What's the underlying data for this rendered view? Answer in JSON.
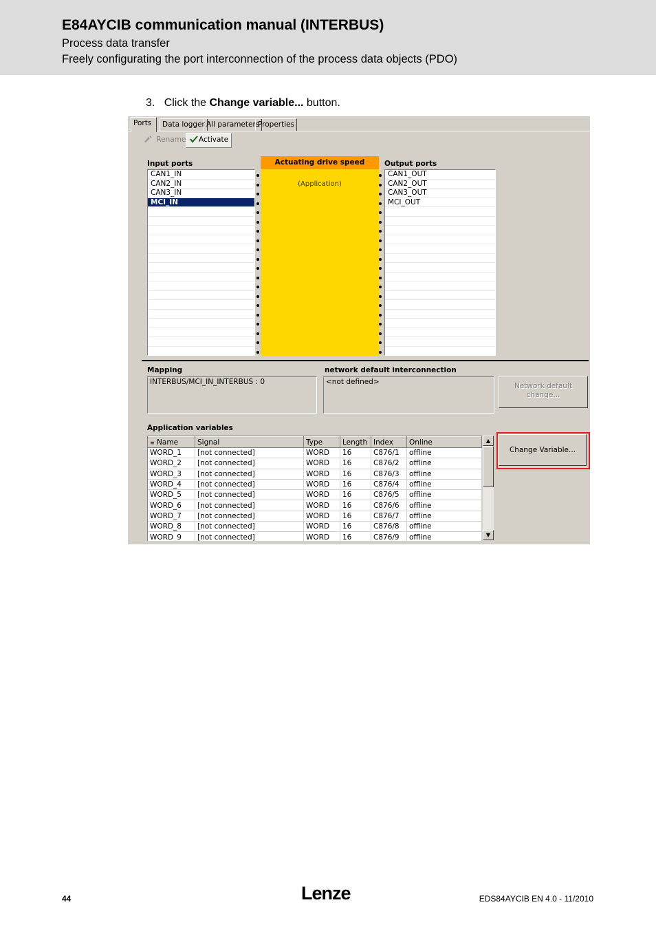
{
  "header": {
    "title": "E84AYCIB communication manual (INTERBUS)",
    "subtitle1": "Process data transfer",
    "subtitle2": "Freely configurating the port interconnection of the process data objects (PDO)"
  },
  "step": {
    "number": "3.",
    "pre": "Click the",
    "bold": "Change variable...",
    "post": "button."
  },
  "screenshot": {
    "tabs": [
      "Ports",
      "Data logger",
      "All parameters",
      "Properties"
    ],
    "toolbar": {
      "rename": "Rename",
      "activate": "Activate"
    },
    "input_ports_label": "Input ports",
    "input_ports": [
      "CAN1_IN",
      "CAN2_IN",
      "CAN3_IN",
      "MCI_IN"
    ],
    "selected_input": "MCI_IN",
    "block_title": "Actuating drive speed",
    "block_sub": "(Application)",
    "output_ports_label": "Output ports",
    "output_ports": [
      "CAN1_OUT",
      "CAN2_OUT",
      "CAN3_OUT",
      "MCI_OUT"
    ],
    "mapping_label": "Mapping",
    "mapping_value": "INTERBUS/MCI_IN_INTERBUS : 0",
    "network_label": "network default interconnection",
    "network_value": "<not defined>",
    "network_button": "Network default change...",
    "app_vars_label": "Application variables",
    "change_variable_button": "Change Variable...",
    "columns": [
      "Name",
      "Signal",
      "Type",
      "Length",
      "Index",
      "Online"
    ],
    "rows": [
      [
        "WORD_1",
        "[not connected]",
        "WORD",
        "16",
        "C876/1",
        "offline"
      ],
      [
        "WORD_2",
        "[not connected]",
        "WORD",
        "16",
        "C876/2",
        "offline"
      ],
      [
        "WORD_3",
        "[not connected]",
        "WORD",
        "16",
        "C876/3",
        "offline"
      ],
      [
        "WORD_4",
        "[not connected]",
        "WORD",
        "16",
        "C876/4",
        "offline"
      ],
      [
        "WORD_5",
        "[not connected]",
        "WORD",
        "16",
        "C876/5",
        "offline"
      ],
      [
        "WORD_6",
        "[not connected]",
        "WORD",
        "16",
        "C876/6",
        "offline"
      ],
      [
        "WORD_7",
        "[not connected]",
        "WORD",
        "16",
        "C876/7",
        "offline"
      ],
      [
        "WORD_8",
        "[not connected]",
        "WORD",
        "16",
        "C876/8",
        "offline"
      ],
      [
        "WORD_9",
        "[not connected]",
        "WORD",
        "16",
        "C876/9",
        "offline"
      ]
    ]
  },
  "footer": {
    "page": "44",
    "logo": "Lenze",
    "doc": "EDS84AYCIB EN 4.0 - 11/2010"
  }
}
